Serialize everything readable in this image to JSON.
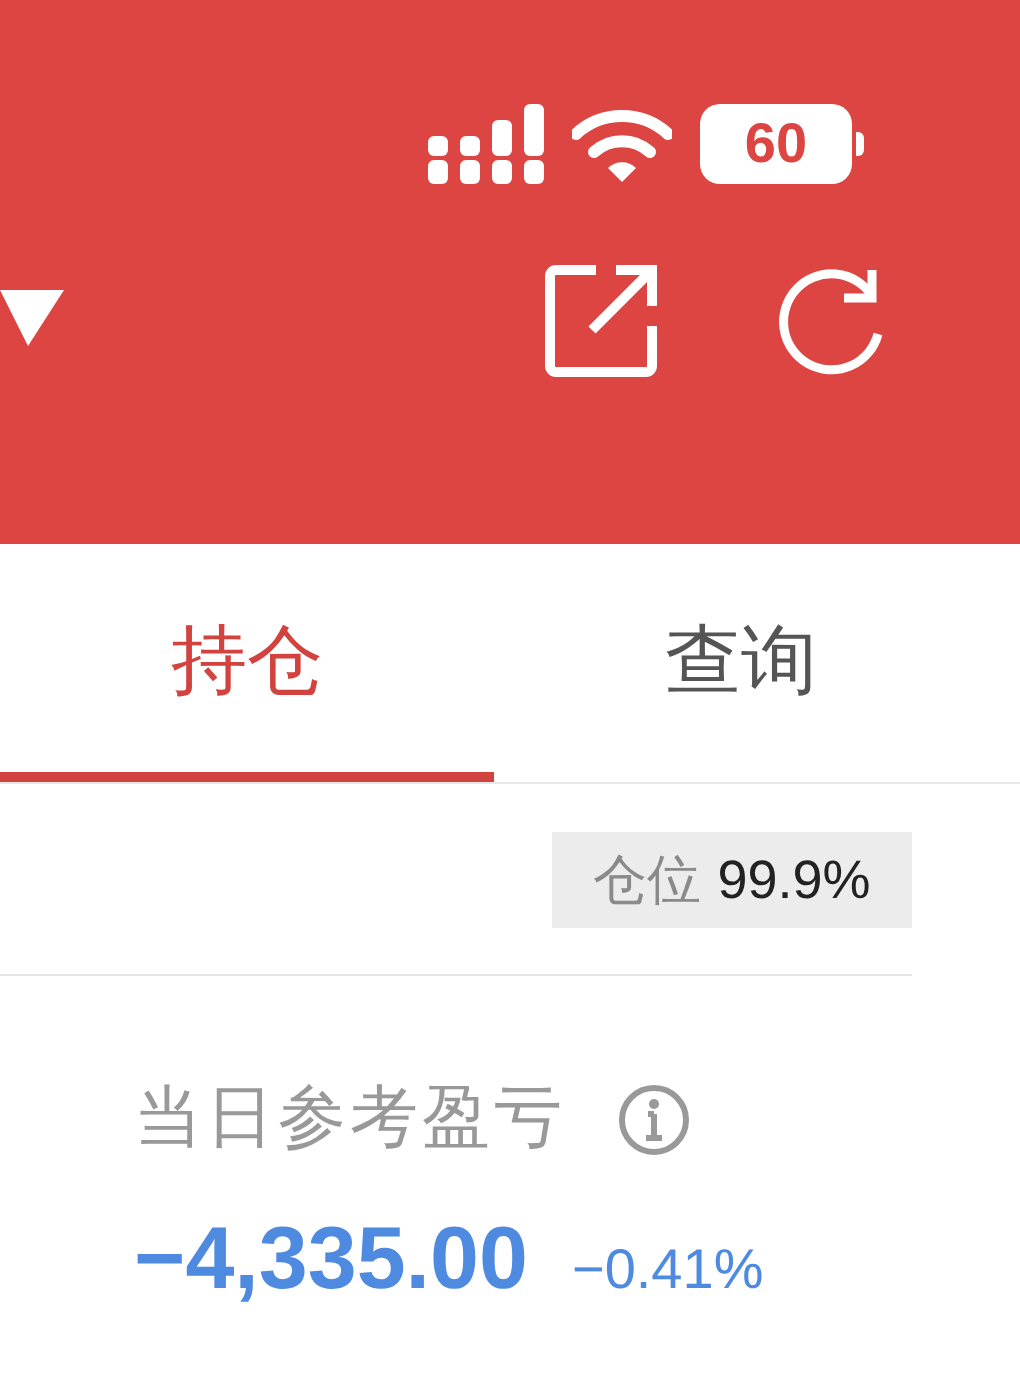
{
  "status_bar": {
    "battery": "60"
  },
  "tabs": [
    {
      "label": "持仓",
      "selected": true
    },
    {
      "label": "查询",
      "selected": false
    }
  ],
  "position": {
    "label": "仓位",
    "value": "99.9%"
  },
  "daily_pnl": {
    "label": "当日参考盈亏",
    "value": "−4,335.00",
    "percent": "−0.41%"
  }
}
